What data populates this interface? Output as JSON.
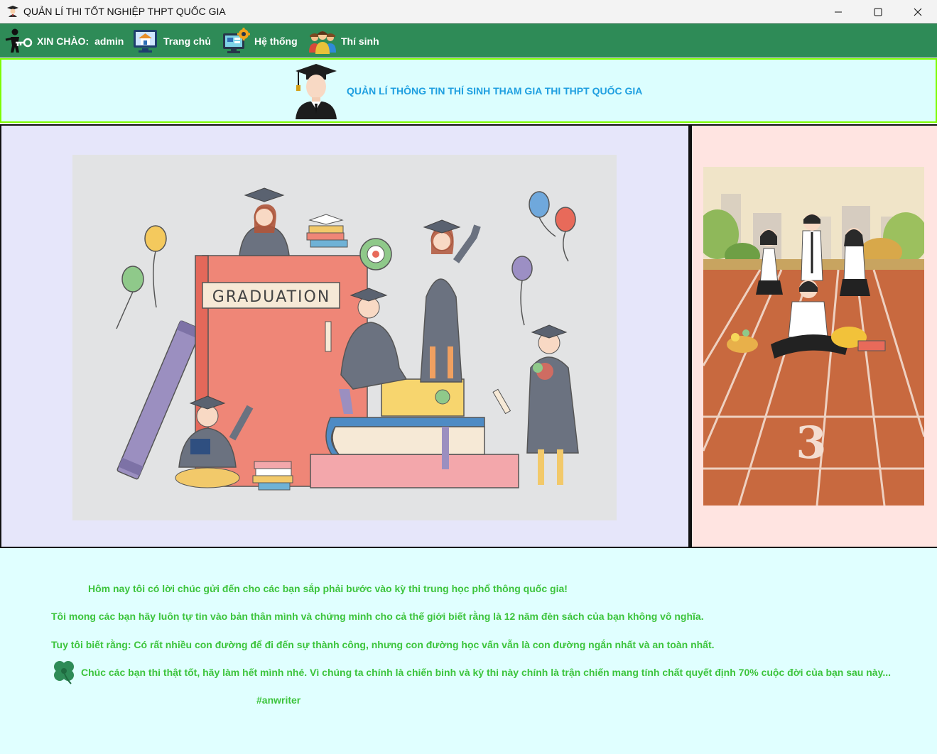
{
  "window": {
    "title": "QUẢN LÍ THI TỐT NGHIỆP THPT QUỐC GIA",
    "icon": "graduate-icon",
    "controls": [
      "minimize",
      "maximize",
      "close"
    ]
  },
  "menubar": {
    "greeting_label": "XIN CHÀO:",
    "username": "admin",
    "items": [
      {
        "label": "Trang chủ",
        "icon": "home-computer-icon"
      },
      {
        "label": "Hệ thống",
        "icon": "system-settings-icon"
      },
      {
        "label": "Thí sinh",
        "icon": "students-icon"
      }
    ],
    "background": "#2e8b57"
  },
  "banner": {
    "title": "QUẢN LÍ THÔNG TIN THÍ SINH THAM GIA THI THPT QUỐC GIA",
    "title_color": "#1e9fe0",
    "icon": "graduate-avatar-icon"
  },
  "images": {
    "left": {
      "label": "GRADUATION",
      "kind": "graduation-illustration"
    },
    "right": {
      "label": "3",
      "kind": "running-track-students-illustration"
    }
  },
  "message": {
    "lines": [
      "Hôm nay tôi có lời chúc gửi đến cho các bạn sắp phải bước vào kỳ thi trung học phổ thông quốc gia!",
      "Tôi mong các bạn hãy luôn tự tin vào bản thân mình và chứng minh cho cả thế giới biết rằng là 12 năm đèn sách của bạn không vô nghĩa.",
      "Tuy tôi biết rằng: Có rất nhiều con đường để đi đến sự thành công, nhưng con đường học vấn vẫn là con đường ngắn nhất và an toàn nhất.",
      "Chúc các bạn thi thật tốt, hãy làm hết mình nhé. Vì chúng ta chính là chiến binh và kỳ thi này chính là trận chiến mang tính chất quyết định 70% cuộc đời của bạn sau này...",
      "#anwriter"
    ],
    "text_color": "#3cc43c",
    "background": "#e0ffff"
  },
  "colors": {
    "banner_bg": "#dcfefe",
    "banner_border": "#7cfc00",
    "left_panel_bg": "#e6e6fa",
    "right_panel_bg": "#ffe4e1"
  }
}
